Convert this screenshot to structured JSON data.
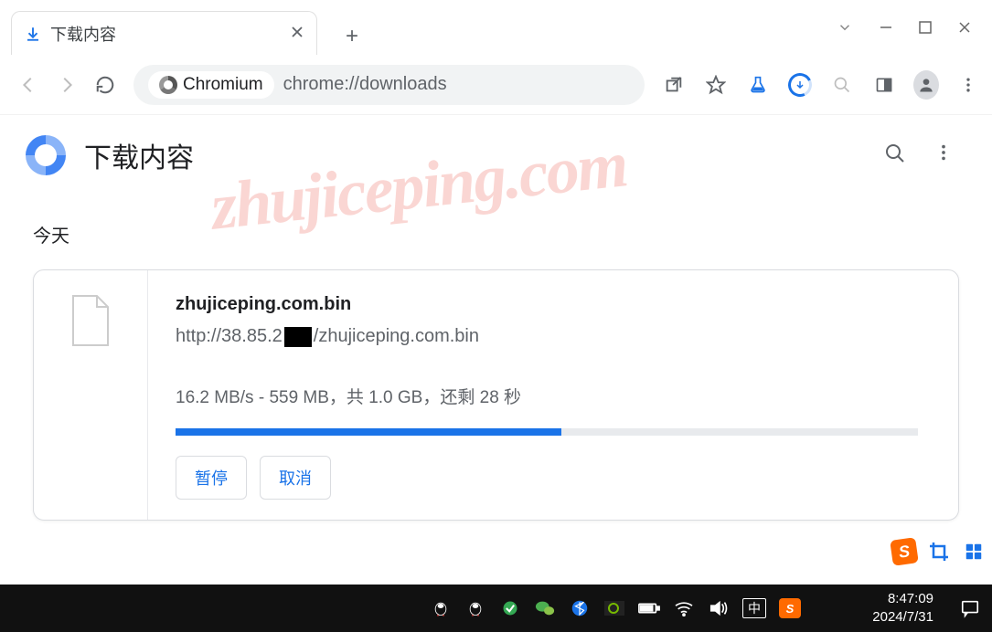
{
  "window": {
    "tab_title": "下载内容",
    "newtab_glyph": "+"
  },
  "addressbar": {
    "chip": "Chromium",
    "url_scheme": "chrome://",
    "url_path": "downloads"
  },
  "page_header": {
    "title": "下载内容"
  },
  "section_label": "今天",
  "download": {
    "filename": "zhujiceping.com.bin",
    "url_prefix": "http://38.85.2",
    "url_suffix": "/zhujiceping.com.bin",
    "speed": "16.2 MB/s",
    "downloaded": "559 MB",
    "total": "1.0 GB",
    "eta": "28 秒",
    "sep1": " - ",
    "sep2": "，共 ",
    "sep3": "，还剩 ",
    "pause_label": "暂停",
    "cancel_label": "取消",
    "progress_percent": 52
  },
  "watermark": "zhujiceping.com",
  "tray": {
    "s_label": "S"
  },
  "taskbar": {
    "ime": "中",
    "s_label": "S",
    "time": "8:47:09",
    "date": "2024/7/31"
  }
}
